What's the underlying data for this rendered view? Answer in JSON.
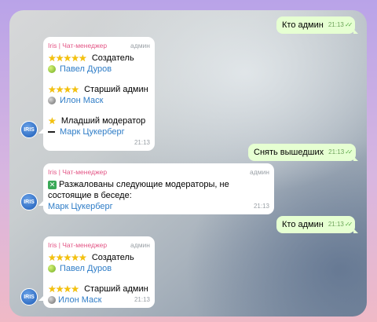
{
  "messages": [
    {
      "id": "m1",
      "text": "Кто админ",
      "time": "21:13"
    },
    {
      "id": "m2",
      "sender": "Iris | Чат-менеджер",
      "role": "админ",
      "time": "21:13",
      "lines": {
        "creator_title": "Создатель",
        "creator_name": "Павел Дуров",
        "senior_title": "Старший админ",
        "senior_name": "Илон Маск",
        "junior_title": "Младший модератор",
        "junior_name": "Марк Цукерберг"
      }
    },
    {
      "id": "m3",
      "text": "Снять вышедших",
      "time": "21:13"
    },
    {
      "id": "m4",
      "sender": "Iris | Чат-менеджер",
      "role": "админ",
      "time": "21:13",
      "text": "Разжалованы следующие модераторы, не состоящие в беседе:",
      "name": "Марк Цукерберг"
    },
    {
      "id": "m5",
      "text": "Кто админ",
      "time": "21:13"
    },
    {
      "id": "m6",
      "sender": "Iris | Чат-менеджер",
      "role": "админ",
      "time": "21:13",
      "lines": {
        "creator_title": "Создатель",
        "creator_name": "Павел Дуров",
        "senior_title": "Старший админ",
        "senior_name": "Илон Маск"
      }
    }
  ],
  "avatar_label": "IRIS",
  "icons": {
    "stars": "star-rating-icon",
    "creator_badge": "green-ball-icon",
    "senior_badge": "gray-ball-icon",
    "junior_badge": "dash-icon",
    "check": "double-check-icon",
    "x": "cross-mark-icon"
  },
  "colors": {
    "accent": "#e35585",
    "link": "#2f7dc7",
    "out_bubble": "#e6ffd2"
  }
}
